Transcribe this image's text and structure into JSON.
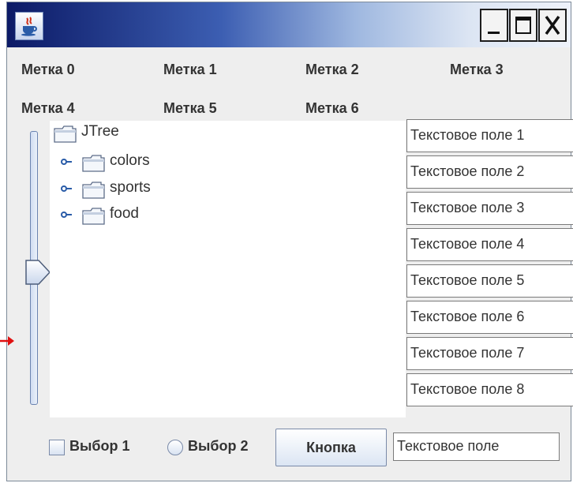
{
  "labels": [
    "Метка 0",
    "Метка 1",
    "Метка 2",
    "Метка 3",
    "Метка 4",
    "Метка 5",
    "Метка 6"
  ],
  "tree": {
    "root": "JTree",
    "children": [
      "colors",
      "sports",
      "food"
    ]
  },
  "text_fields": [
    "Текстовое поле 1",
    "Текстовое поле 2",
    "Текстовое поле 3",
    "Текстовое поле 4",
    "Текстовое поле 5",
    "Текстовое поле 6",
    "Текстовое поле 7",
    "Текстовое поле 8"
  ],
  "bottom": {
    "checkbox_label": "Выбор 1",
    "radio_label": "Выбор 2",
    "button_label": "Кнопка",
    "text_field_value": "Текстовое поле"
  },
  "colors": {
    "title_gradient_start": "#0c1a66",
    "window_bg": "#eeeeee",
    "arrow": "#e01010"
  }
}
